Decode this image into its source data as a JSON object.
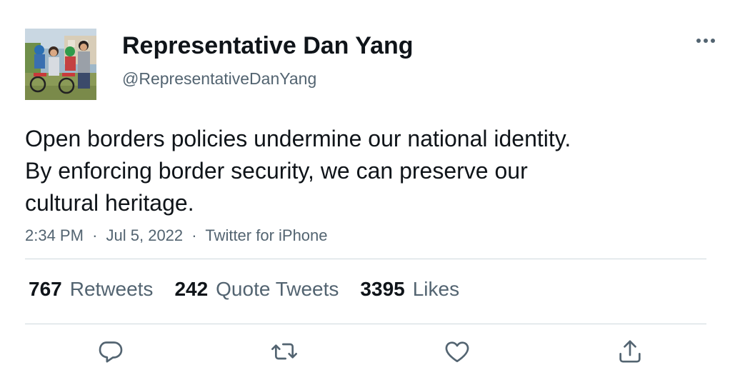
{
  "author": {
    "display_name": "Representative Dan Yang",
    "handle": "@RepresentativeDanYang",
    "avatar_icon": "family-photo-avatar"
  },
  "tweet": {
    "text_lines": [
      "Open borders policies undermine our national identity.",
      "By enforcing border security, we can preserve our",
      "cultural heritage."
    ],
    "time": "2:34 PM",
    "date": "Jul 5, 2022",
    "source": "Twitter for iPhone",
    "separator": "·"
  },
  "stats": {
    "retweets": {
      "count": "767",
      "label": "Retweets"
    },
    "quote_tweets": {
      "count": "242",
      "label": "Quote Tweets"
    },
    "likes": {
      "count": "3395",
      "label": "Likes"
    }
  },
  "actions": {
    "reply_icon": "reply-icon",
    "retweet_icon": "retweet-icon",
    "like_icon": "heart-icon",
    "share_icon": "share-icon"
  },
  "colors": {
    "text_primary": "#0f1419",
    "text_secondary": "#536471",
    "divider": "#cfd9de"
  }
}
